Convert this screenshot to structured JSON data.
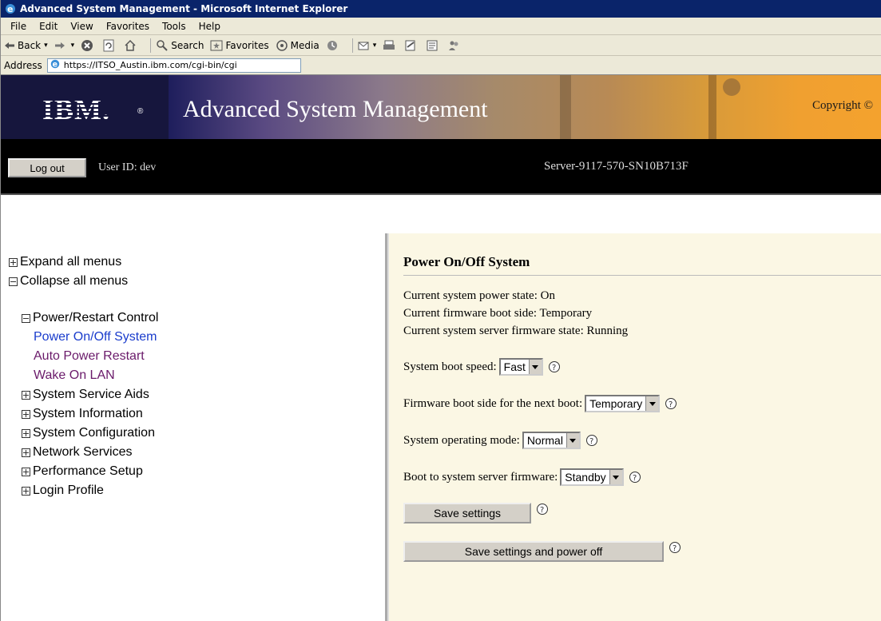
{
  "window": {
    "title": "Advanced System Management - Microsoft Internet Explorer"
  },
  "menu": [
    "File",
    "Edit",
    "View",
    "Favorites",
    "Tools",
    "Help"
  ],
  "toolbar": {
    "back": "Back",
    "search": "Search",
    "favorites": "Favorites",
    "media": "Media"
  },
  "address": {
    "label": "Address",
    "url": "https://ITSO_Austin.ibm.com/cgi-bin/cgi"
  },
  "banner": {
    "logo": "IBM.",
    "title": "Advanced System Management",
    "copyright": "Copyright ©"
  },
  "userbar": {
    "logout": "Log out",
    "user_id": "User ID: dev",
    "server": "Server-9117-570-SN10B713F"
  },
  "nav": {
    "expand_all": "Expand all menus",
    "collapse_all": "Collapse all menus",
    "power_restart": "Power/Restart Control",
    "power_children": [
      "Power On/Off System",
      "Auto Power Restart",
      "Wake On LAN"
    ],
    "groups": [
      "System Service Aids",
      "System Information",
      "System Configuration",
      "Network Services",
      "Performance Setup",
      "Login Profile"
    ]
  },
  "main": {
    "heading": "Power On/Off System",
    "status": [
      "Current system power state: On",
      "Current firmware boot side: Temporary",
      "Current system server firmware state: Running"
    ],
    "settings": [
      {
        "label": "System boot speed:",
        "value": "Fast"
      },
      {
        "label": "Firmware boot side for the next boot:",
        "value": "Temporary"
      },
      {
        "label": "System operating mode:",
        "value": "Normal"
      },
      {
        "label": "Boot to system server firmware:",
        "value": "Standby"
      }
    ],
    "save_label": "Save settings",
    "save_power_off_label": "Save settings and power off"
  }
}
